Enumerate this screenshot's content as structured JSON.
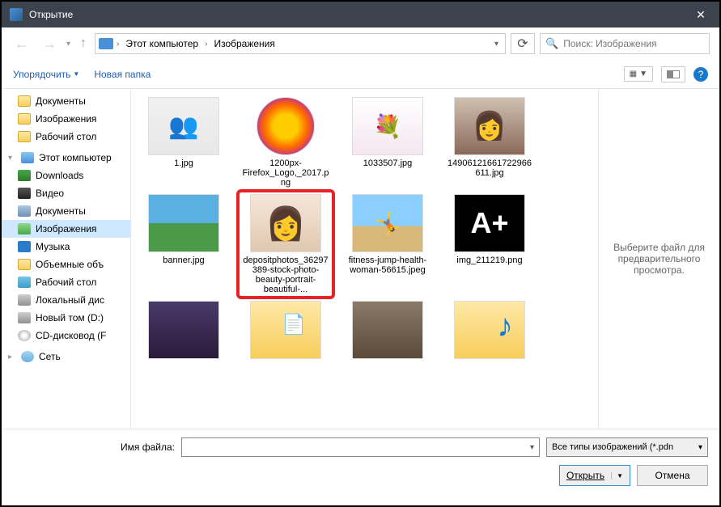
{
  "titlebar": {
    "title": "Открытие"
  },
  "nav": {
    "crumb1": "Этот компьютер",
    "crumb2": "Изображения"
  },
  "search": {
    "placeholder": "Поиск: Изображения"
  },
  "toolbar": {
    "organize": "Упорядочить",
    "new_folder": "Новая папка"
  },
  "sidebar": {
    "quick": [
      {
        "label": "Документы",
        "icon": "folder"
      },
      {
        "label": "Изображения",
        "icon": "folder"
      },
      {
        "label": "Рабочий стол",
        "icon": "folder"
      }
    ],
    "this_pc_label": "Этот компьютер",
    "pc_items": [
      {
        "label": "Downloads",
        "icon": "dl"
      },
      {
        "label": "Видео",
        "icon": "video"
      },
      {
        "label": "Документы",
        "icon": "docs"
      },
      {
        "label": "Изображения",
        "icon": "img",
        "selected": true
      },
      {
        "label": "Музыка",
        "icon": "music"
      },
      {
        "label": "Объемные объ",
        "icon": "folder"
      },
      {
        "label": "Рабочий стол",
        "icon": "desk"
      },
      {
        "label": "Локальный дис",
        "icon": "disk"
      },
      {
        "label": "Новый том (D:)",
        "icon": "disk"
      },
      {
        "label": "CD-дисковод (F",
        "icon": "cd"
      }
    ],
    "network_label": "Сеть"
  },
  "files": [
    {
      "name": "1.jpg",
      "thumb": "people"
    },
    {
      "name": "1200px-Firefox_Logo,_2017.png",
      "thumb": "firefox"
    },
    {
      "name": "1033507.jpg",
      "thumb": "flowers"
    },
    {
      "name": "14906121661722966611.jpg",
      "thumb": "portrait1"
    },
    {
      "name": "banner.jpg",
      "thumb": "banner"
    },
    {
      "name": "depositphotos_36297389-stock-photo-beauty-portrait-beautiful-...",
      "thumb": "face",
      "highlighted": true
    },
    {
      "name": "fitness-jump-health-woman-56615.jpeg",
      "thumb": "fitness"
    },
    {
      "name": "img_211219.png",
      "thumb": "aplus"
    },
    {
      "name": "",
      "thumb": "painting"
    },
    {
      "name": "",
      "thumb": "docfolder"
    },
    {
      "name": "",
      "thumb": "photo"
    },
    {
      "name": "",
      "thumb": "musicfolder"
    }
  ],
  "preview_message": "Выберите файл для предварительного просмотра.",
  "bottom": {
    "filename_label": "Имя файла:",
    "filter": "Все типы изображений (*.pdn",
    "open": "Открыть",
    "cancel": "Отмена"
  }
}
